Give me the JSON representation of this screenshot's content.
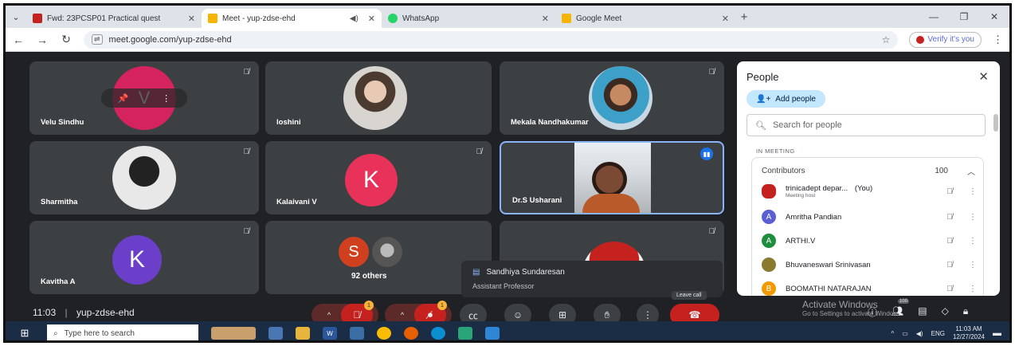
{
  "browser": {
    "tabs": [
      {
        "title": "Fwd: 23PCSP01 Practical quest",
        "icon_color": "#c5221f"
      },
      {
        "title": "Meet - yup-zdse-ehd",
        "icon_color": "#f4b400",
        "active": true
      },
      {
        "title": "WhatsApp",
        "icon_color": "#25d366"
      },
      {
        "title": "Google Meet",
        "icon_color": "#f4b400"
      }
    ],
    "url": "meet.google.com/yup-zdse-ehd",
    "verify_label": "Verify it's you"
  },
  "tiles": [
    {
      "name": "Velu Sindhu",
      "initial": "V",
      "color": "#d5235f"
    },
    {
      "name": "loshini"
    },
    {
      "name": "Mekala Nandhakumar"
    },
    {
      "name": "Sharmitha"
    },
    {
      "name": "Kalaivani V",
      "initial": "K",
      "color": "#e8325a"
    },
    {
      "name": "Dr.S Usharani"
    },
    {
      "name": "Kavitha A",
      "initial": "K",
      "color": "#6b3fc9"
    },
    {
      "name": "92 others",
      "initial": "S",
      "color": "#d0401f"
    },
    {
      "name": ""
    }
  ],
  "people_panel": {
    "title": "People",
    "add_people": "Add people",
    "search_placeholder": "Search for people",
    "section_label": "IN MEETING",
    "contributors_label": "Contributors",
    "contributors_count": "100",
    "people": [
      {
        "name": "trinicadept depar...",
        "you": "(You)",
        "sub": "Meeting host",
        "initial": "",
        "color": "#c5221f"
      },
      {
        "name": "Amritha Pandian",
        "initial": "A",
        "color": "#5b5fd6"
      },
      {
        "name": "ARTHI.V",
        "initial": "A",
        "color": "#1e8e3e"
      },
      {
        "name": "Bhuvaneswari Srinivasan",
        "initial": "",
        "color": "#8a7a2e"
      },
      {
        "name": "BOOMATHI NATARAJAN",
        "initial": "B",
        "color": "#f29900"
      }
    ]
  },
  "popup": {
    "name": "Sandhiya Sundaresan",
    "role": "Assistant Professor"
  },
  "leave_label": "Leave call",
  "meeting_time": "11:03",
  "meeting_code": "yup-zdse-ehd",
  "badge_1": "1",
  "badge_2": "1",
  "badge_count": "100",
  "activate_title": "Activate Windows",
  "activate_sub": "Go to Settings to activate Windows.",
  "taskbar": {
    "search_placeholder": "Type here to search",
    "lang": "ENG",
    "time": "11:03 AM",
    "date": "12/27/2024"
  }
}
